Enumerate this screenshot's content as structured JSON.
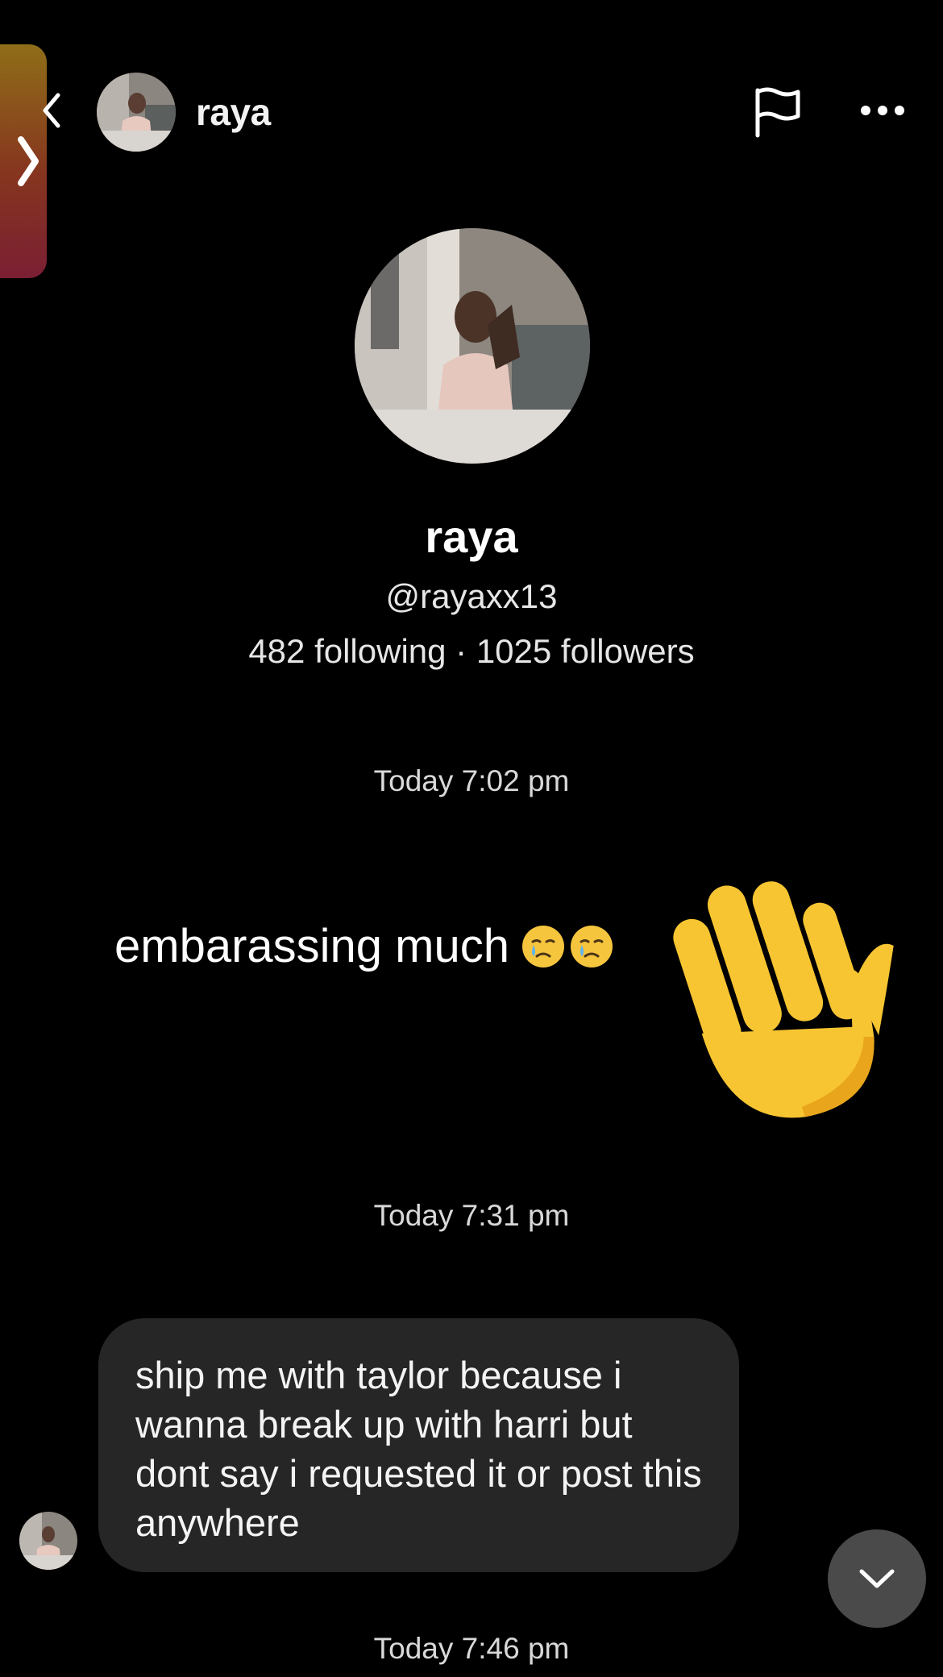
{
  "header": {
    "back_icon": "chevron-left-icon",
    "name": "raya",
    "flag_icon": "flag-icon",
    "more_icon": "more-horizontal-icon"
  },
  "profile": {
    "name": "raya",
    "handle": "@rayaxx13",
    "stats": "482 following · 1025 followers"
  },
  "timestamps": {
    "first": "Today 7:02 pm",
    "second": "Today 7:31 pm",
    "third": "Today 7:46 pm"
  },
  "overlay": {
    "caption": "embarassing much",
    "emoji_icon": "crying-smile-emoji",
    "sticker_icon": "waving-hand-emoji"
  },
  "message": {
    "text": "ship me with taylor because i wanna break up with harri but dont say i requested it or post this anywhere"
  },
  "controls": {
    "scroll_down_icon": "chevron-down-icon",
    "edge_tab_icon": "chevron-right-icon"
  },
  "colors": {
    "background": "#000000",
    "bubble": "#262626",
    "scroll_button": "#4a4a4a",
    "edge_tab_top": "#8f6e18",
    "edge_tab_bottom": "#7a1f33"
  }
}
